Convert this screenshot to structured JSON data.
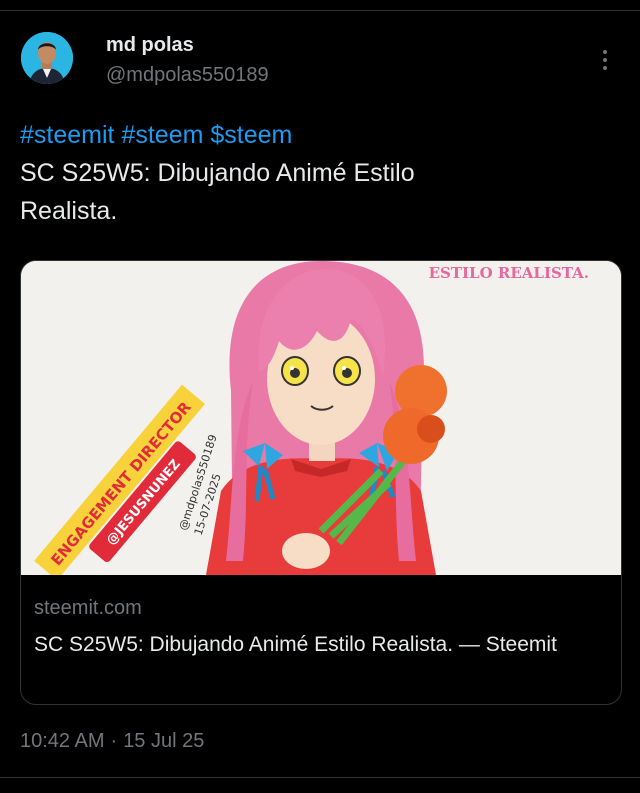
{
  "author": {
    "display_name": "md polas",
    "handle": "@mdpolas550189"
  },
  "post": {
    "hashtags": [
      "#steemit",
      "#steem",
      "$steem"
    ],
    "text_line1": "SC S25W5: Dibujando Animé Estilo",
    "text_line2": "Realista."
  },
  "link_card": {
    "image_overlay_title": "ESTILO REALISTA.",
    "badge_line1": "ENGAGEMENT DIRECTOR",
    "badge_line2": "@JESUSNUNEZ",
    "signature_text": "@mdpolas550189",
    "signature_date": "15-07-2025",
    "domain": "steemit.com",
    "title": "SC S25W5: Dibujando Animé Estilo Realista. — Steemit"
  },
  "meta": {
    "time": "10:42 AM",
    "separator": "·",
    "date": "15 Jul 25"
  },
  "colors": {
    "background": "#000000",
    "link": "#1d9bf0",
    "muted": "#71767b",
    "text": "#e7e9ea"
  },
  "icons": {
    "more": "more-vertical-icon"
  }
}
